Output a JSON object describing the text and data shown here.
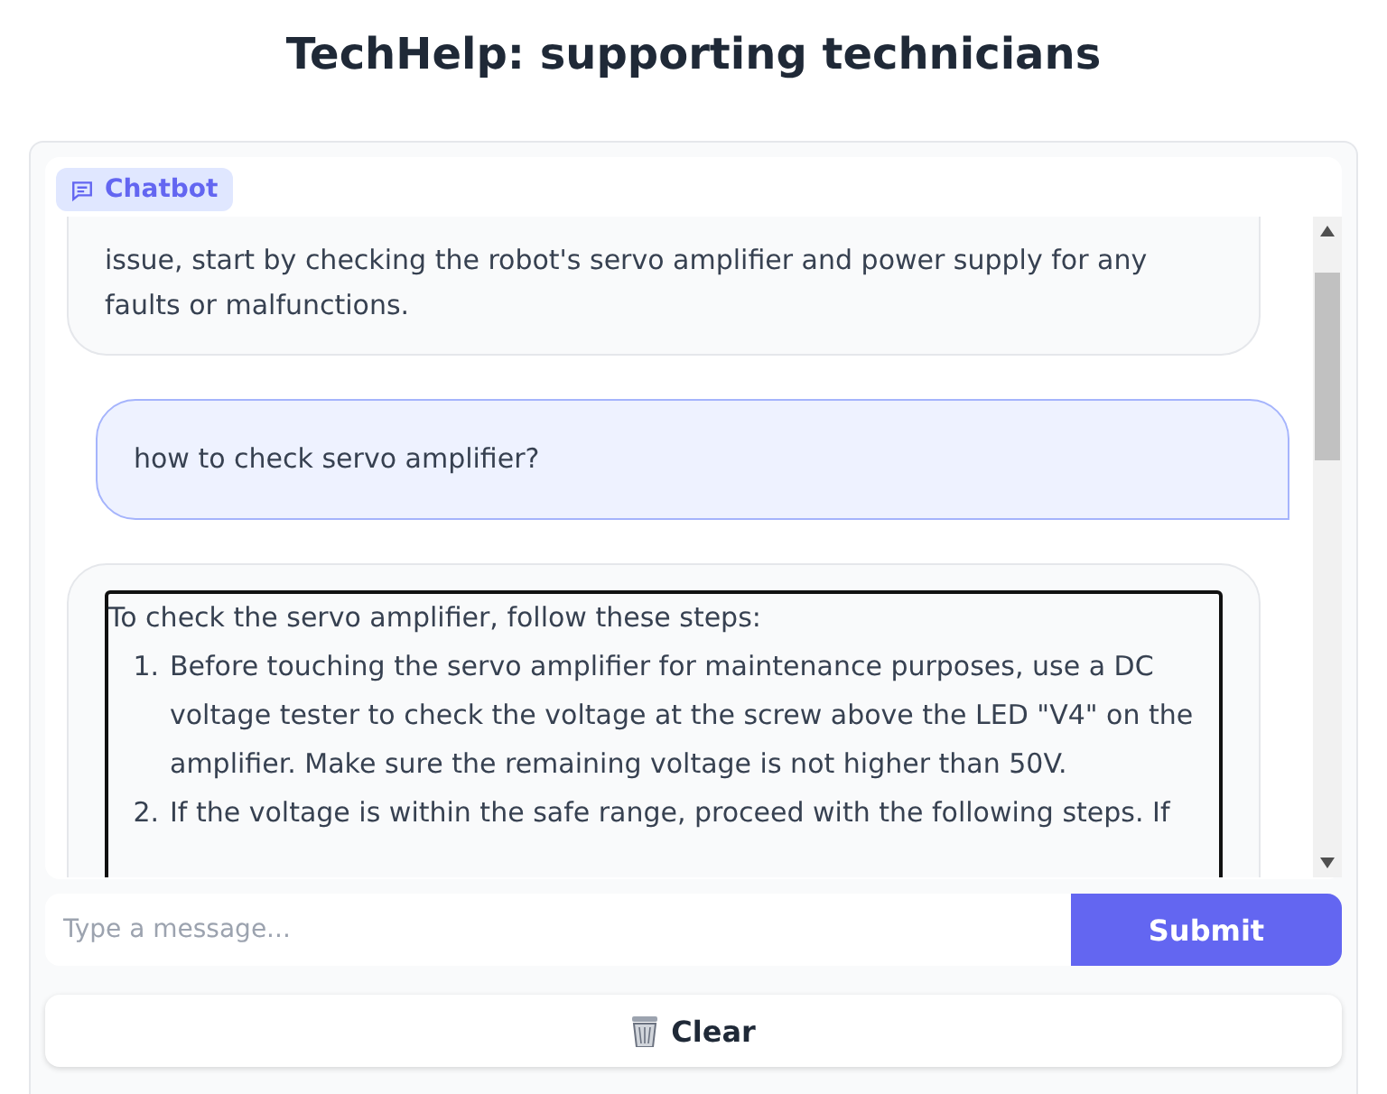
{
  "title": "TechHelp: supporting technicians",
  "chat": {
    "label": "Chatbot",
    "messages": [
      {
        "outgoing": false,
        "kind": "text",
        "text": "issue, start by checking the robot's servo amplifier and power supply for any faults or malfunctions."
      },
      {
        "outgoing": true,
        "kind": "text",
        "text": "how to check servo amplifier?"
      },
      {
        "outgoing": false,
        "kind": "steps",
        "intro": "To check the servo amplifier, follow these steps:",
        "steps": [
          {
            "number": "1.",
            "text": "Before touching the servo amplifier for maintenance purposes, use a DC voltage tester to check the voltage at the screw above the LED \"V4\" on the amplifier. Make sure the remaining voltage is not higher than 50V."
          },
          {
            "number": "2.",
            "text": "If the voltage is within the safe range, proceed with the following steps. If"
          }
        ]
      }
    ]
  },
  "input": {
    "placeholder": "Type a message..."
  },
  "submit": "Submit",
  "clear": "Clear"
}
